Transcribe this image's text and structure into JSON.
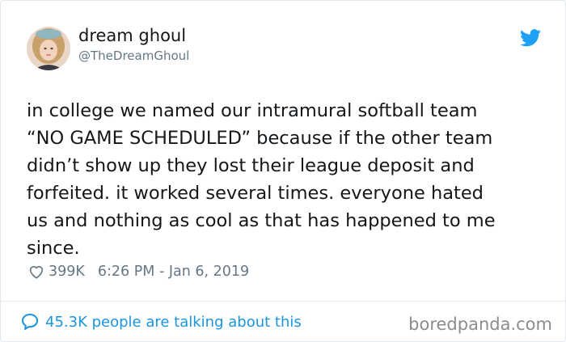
{
  "author": {
    "display_name": "dream ghoul",
    "handle": "@TheDreamGhoul",
    "avatar_icon": "profile-photo"
  },
  "brand_icon": "twitter-bird-icon",
  "brand_color": "#1da1f2",
  "tweet": {
    "lines": [
      "in college we named our intramural softball team",
      "“NO GAME SCHEDULED” because if the other team",
      "didn’t show up they lost their league deposit and",
      "forfeited. it worked several times. everyone hated",
      "us and nothing as cool as that has happened to me",
      "since."
    ],
    "likes": "399K",
    "timestamp": "6:26 PM - Jan 6, 2019"
  },
  "footer": {
    "conversation_label": "45.3K people are talking about this",
    "link_color": "#1b95e0"
  },
  "watermark": "boredpanda.com"
}
